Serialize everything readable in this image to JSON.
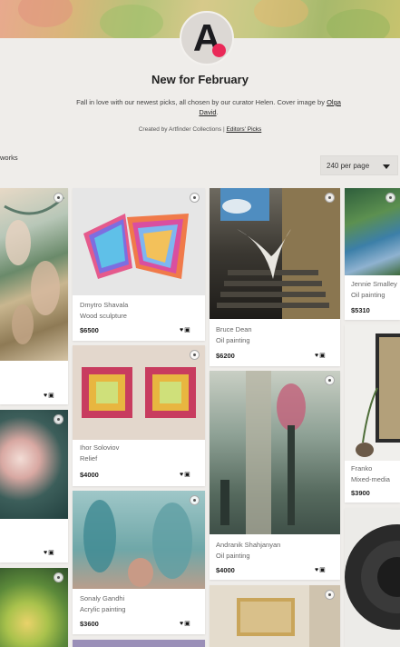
{
  "collection": {
    "logo_letter": "A",
    "title": "New for February",
    "description_text": "Fall in love with our newest picks, all chosen by our curator Helen. Cover image by ",
    "cover_artist": "Olga David",
    "description_end": ".",
    "created_by_text": "Created by Artfinder Collections | ",
    "created_by_link": "Editors' Picks"
  },
  "toolbar": {
    "works_label": "works",
    "per_page": "240 per page"
  },
  "artworks": [
    {
      "artist": "Dmytro Shavala",
      "medium": "Wood sculpture",
      "price": "$6500"
    },
    {
      "artist": "Ihor Soloviov",
      "medium": "Relief",
      "price": "$4000"
    },
    {
      "artist": "Sonaly Gandhi",
      "medium": "Acrylic painting",
      "price": "$3600"
    },
    {
      "artist": "Bruce Dean",
      "medium": "Oil painting",
      "price": "$6200"
    },
    {
      "artist": "Andranik Shahjanyan",
      "medium": "Oil painting",
      "price": "$4000"
    },
    {
      "artist": "Jennie Smalley",
      "medium": "Oil painting",
      "price": "$5310"
    },
    {
      "artist": "Franko",
      "medium": "Mixed-media",
      "price": "$3900"
    }
  ],
  "icons": {
    "favourite": "heart-icon",
    "basket": "basket-icon",
    "save": "add-to-collection-icon"
  }
}
